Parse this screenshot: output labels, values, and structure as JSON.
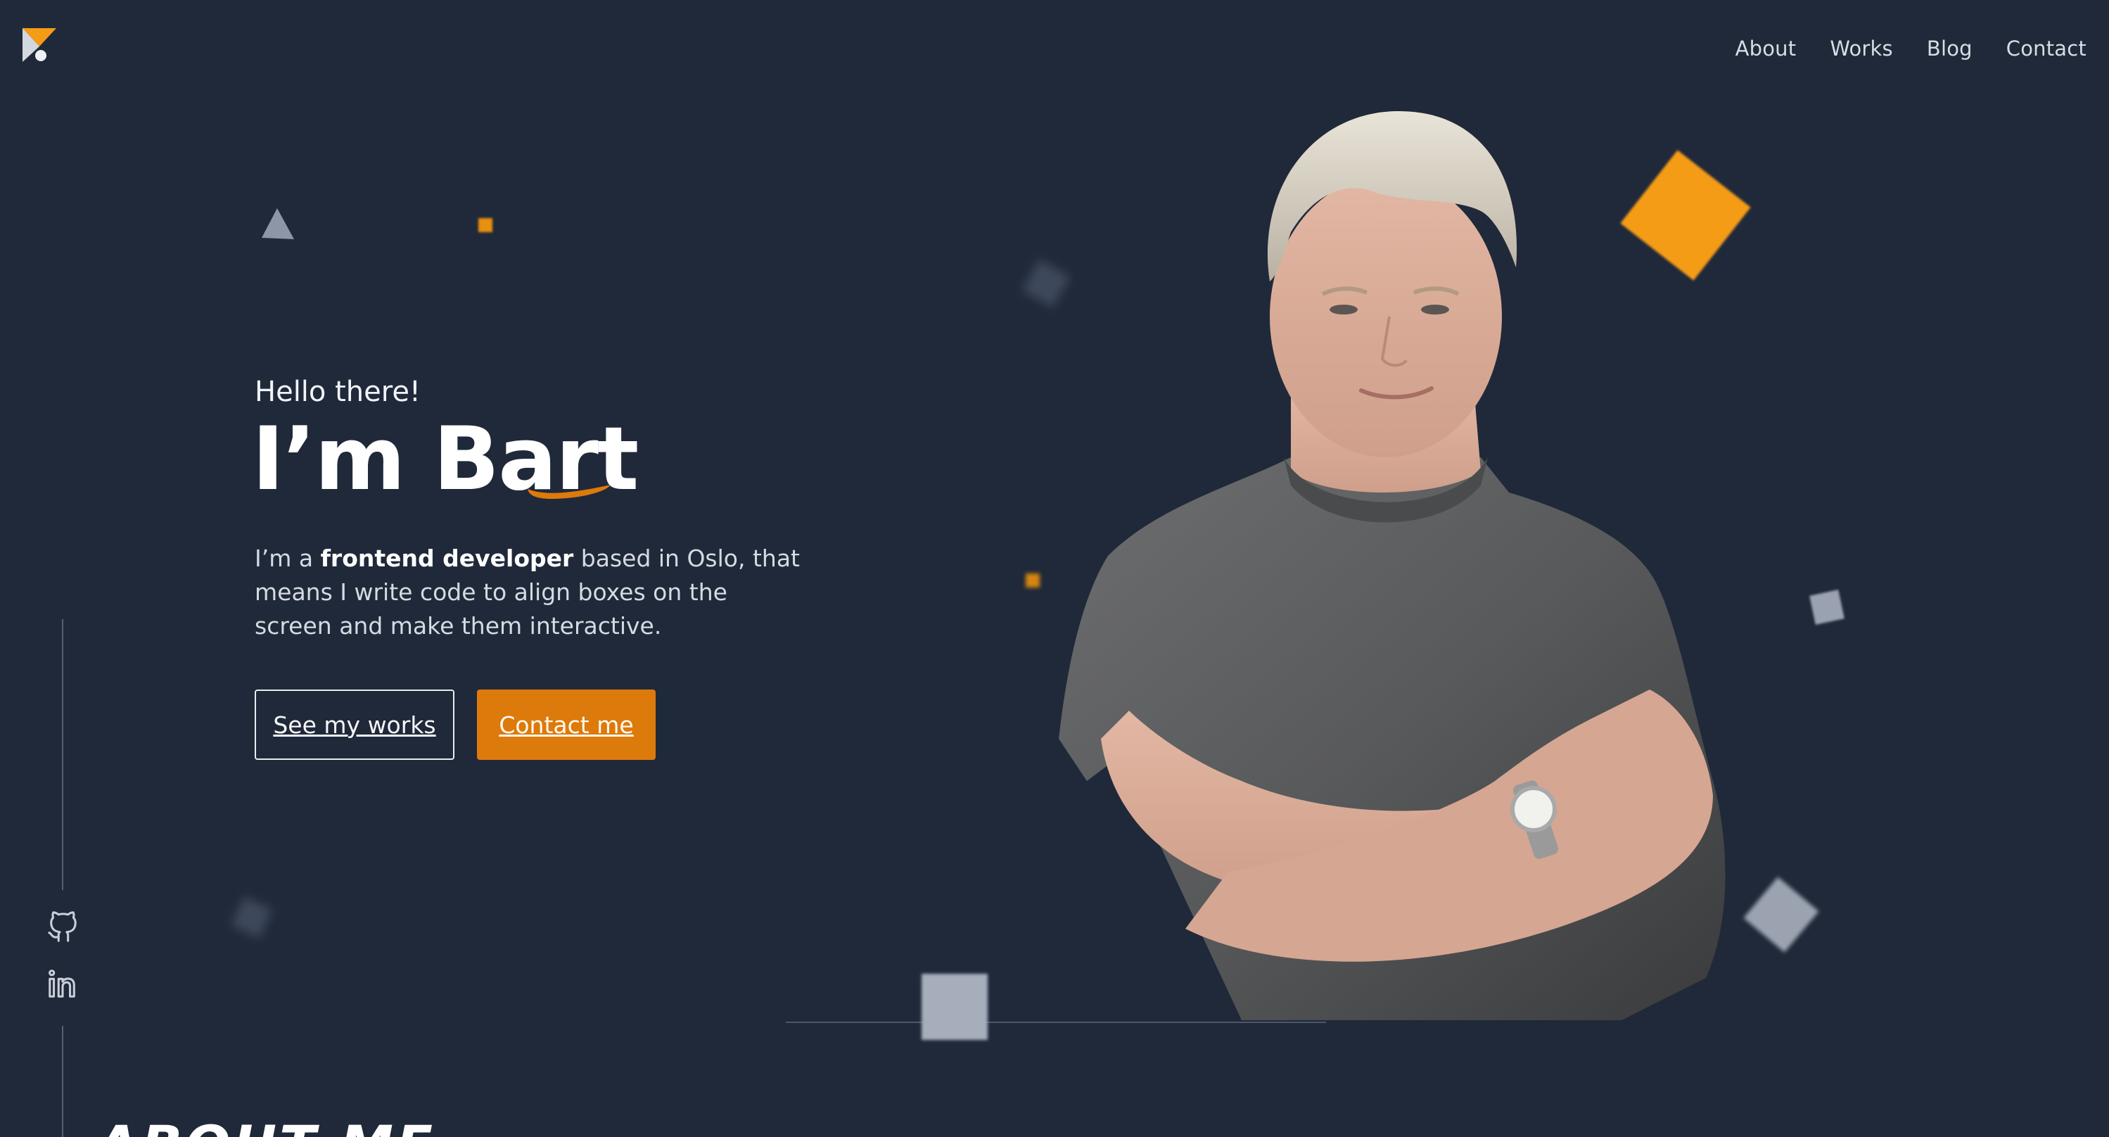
{
  "nav": {
    "items": [
      {
        "label": "About"
      },
      {
        "label": "Works"
      },
      {
        "label": "Blog"
      },
      {
        "label": "Contact"
      }
    ]
  },
  "hero": {
    "greeting": "Hello there!",
    "name": "I’m Bart",
    "description": {
      "prefix": "I’m a ",
      "highlight": "frontend developer",
      "suffix": " based in Oslo, that means I write code to align boxes on the screen and make them interactive."
    },
    "buttons": {
      "works": "See my works",
      "contact": "Contact me"
    }
  },
  "social": {
    "icons": [
      "github-icon",
      "linkedin-icon"
    ]
  },
  "next_section": {
    "heading": "ABOUT ME"
  },
  "colors": {
    "background": "#202939",
    "accent": "#dd7a0c",
    "accent_light": "#f49c16",
    "text": "#ffffff"
  }
}
